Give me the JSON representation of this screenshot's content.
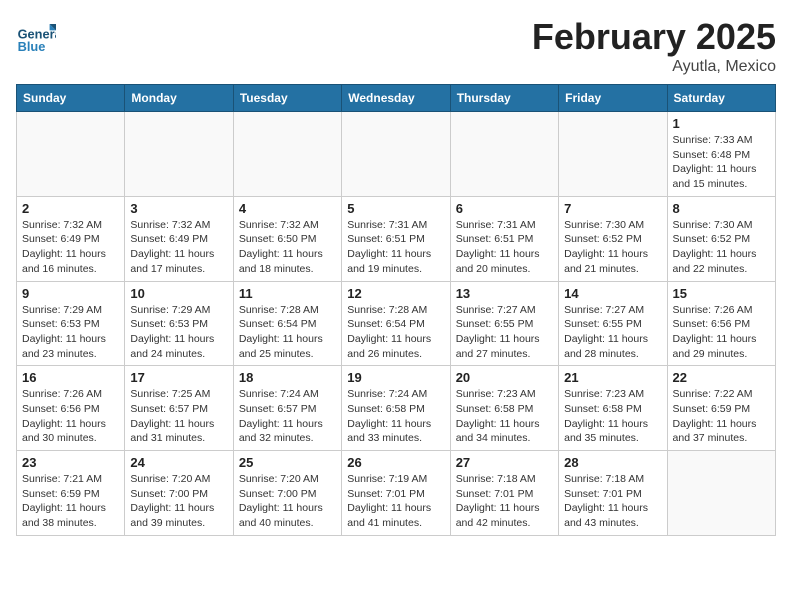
{
  "header": {
    "logo_general": "General",
    "logo_blue": "Blue",
    "month_title": "February 2025",
    "location": "Ayutla, Mexico"
  },
  "calendar": {
    "days_of_week": [
      "Sunday",
      "Monday",
      "Tuesday",
      "Wednesday",
      "Thursday",
      "Friday",
      "Saturday"
    ],
    "weeks": [
      [
        {
          "day": "",
          "info": ""
        },
        {
          "day": "",
          "info": ""
        },
        {
          "day": "",
          "info": ""
        },
        {
          "day": "",
          "info": ""
        },
        {
          "day": "",
          "info": ""
        },
        {
          "day": "",
          "info": ""
        },
        {
          "day": "1",
          "info": "Sunrise: 7:33 AM\nSunset: 6:48 PM\nDaylight: 11 hours and 15 minutes."
        }
      ],
      [
        {
          "day": "2",
          "info": "Sunrise: 7:32 AM\nSunset: 6:49 PM\nDaylight: 11 hours and 16 minutes."
        },
        {
          "day": "3",
          "info": "Sunrise: 7:32 AM\nSunset: 6:49 PM\nDaylight: 11 hours and 17 minutes."
        },
        {
          "day": "4",
          "info": "Sunrise: 7:32 AM\nSunset: 6:50 PM\nDaylight: 11 hours and 18 minutes."
        },
        {
          "day": "5",
          "info": "Sunrise: 7:31 AM\nSunset: 6:51 PM\nDaylight: 11 hours and 19 minutes."
        },
        {
          "day": "6",
          "info": "Sunrise: 7:31 AM\nSunset: 6:51 PM\nDaylight: 11 hours and 20 minutes."
        },
        {
          "day": "7",
          "info": "Sunrise: 7:30 AM\nSunset: 6:52 PM\nDaylight: 11 hours and 21 minutes."
        },
        {
          "day": "8",
          "info": "Sunrise: 7:30 AM\nSunset: 6:52 PM\nDaylight: 11 hours and 22 minutes."
        }
      ],
      [
        {
          "day": "9",
          "info": "Sunrise: 7:29 AM\nSunset: 6:53 PM\nDaylight: 11 hours and 23 minutes."
        },
        {
          "day": "10",
          "info": "Sunrise: 7:29 AM\nSunset: 6:53 PM\nDaylight: 11 hours and 24 minutes."
        },
        {
          "day": "11",
          "info": "Sunrise: 7:28 AM\nSunset: 6:54 PM\nDaylight: 11 hours and 25 minutes."
        },
        {
          "day": "12",
          "info": "Sunrise: 7:28 AM\nSunset: 6:54 PM\nDaylight: 11 hours and 26 minutes."
        },
        {
          "day": "13",
          "info": "Sunrise: 7:27 AM\nSunset: 6:55 PM\nDaylight: 11 hours and 27 minutes."
        },
        {
          "day": "14",
          "info": "Sunrise: 7:27 AM\nSunset: 6:55 PM\nDaylight: 11 hours and 28 minutes."
        },
        {
          "day": "15",
          "info": "Sunrise: 7:26 AM\nSunset: 6:56 PM\nDaylight: 11 hours and 29 minutes."
        }
      ],
      [
        {
          "day": "16",
          "info": "Sunrise: 7:26 AM\nSunset: 6:56 PM\nDaylight: 11 hours and 30 minutes."
        },
        {
          "day": "17",
          "info": "Sunrise: 7:25 AM\nSunset: 6:57 PM\nDaylight: 11 hours and 31 minutes."
        },
        {
          "day": "18",
          "info": "Sunrise: 7:24 AM\nSunset: 6:57 PM\nDaylight: 11 hours and 32 minutes."
        },
        {
          "day": "19",
          "info": "Sunrise: 7:24 AM\nSunset: 6:58 PM\nDaylight: 11 hours and 33 minutes."
        },
        {
          "day": "20",
          "info": "Sunrise: 7:23 AM\nSunset: 6:58 PM\nDaylight: 11 hours and 34 minutes."
        },
        {
          "day": "21",
          "info": "Sunrise: 7:23 AM\nSunset: 6:58 PM\nDaylight: 11 hours and 35 minutes."
        },
        {
          "day": "22",
          "info": "Sunrise: 7:22 AM\nSunset: 6:59 PM\nDaylight: 11 hours and 37 minutes."
        }
      ],
      [
        {
          "day": "23",
          "info": "Sunrise: 7:21 AM\nSunset: 6:59 PM\nDaylight: 11 hours and 38 minutes."
        },
        {
          "day": "24",
          "info": "Sunrise: 7:20 AM\nSunset: 7:00 PM\nDaylight: 11 hours and 39 minutes."
        },
        {
          "day": "25",
          "info": "Sunrise: 7:20 AM\nSunset: 7:00 PM\nDaylight: 11 hours and 40 minutes."
        },
        {
          "day": "26",
          "info": "Sunrise: 7:19 AM\nSunset: 7:01 PM\nDaylight: 11 hours and 41 minutes."
        },
        {
          "day": "27",
          "info": "Sunrise: 7:18 AM\nSunset: 7:01 PM\nDaylight: 11 hours and 42 minutes."
        },
        {
          "day": "28",
          "info": "Sunrise: 7:18 AM\nSunset: 7:01 PM\nDaylight: 11 hours and 43 minutes."
        },
        {
          "day": "",
          "info": ""
        }
      ]
    ]
  }
}
